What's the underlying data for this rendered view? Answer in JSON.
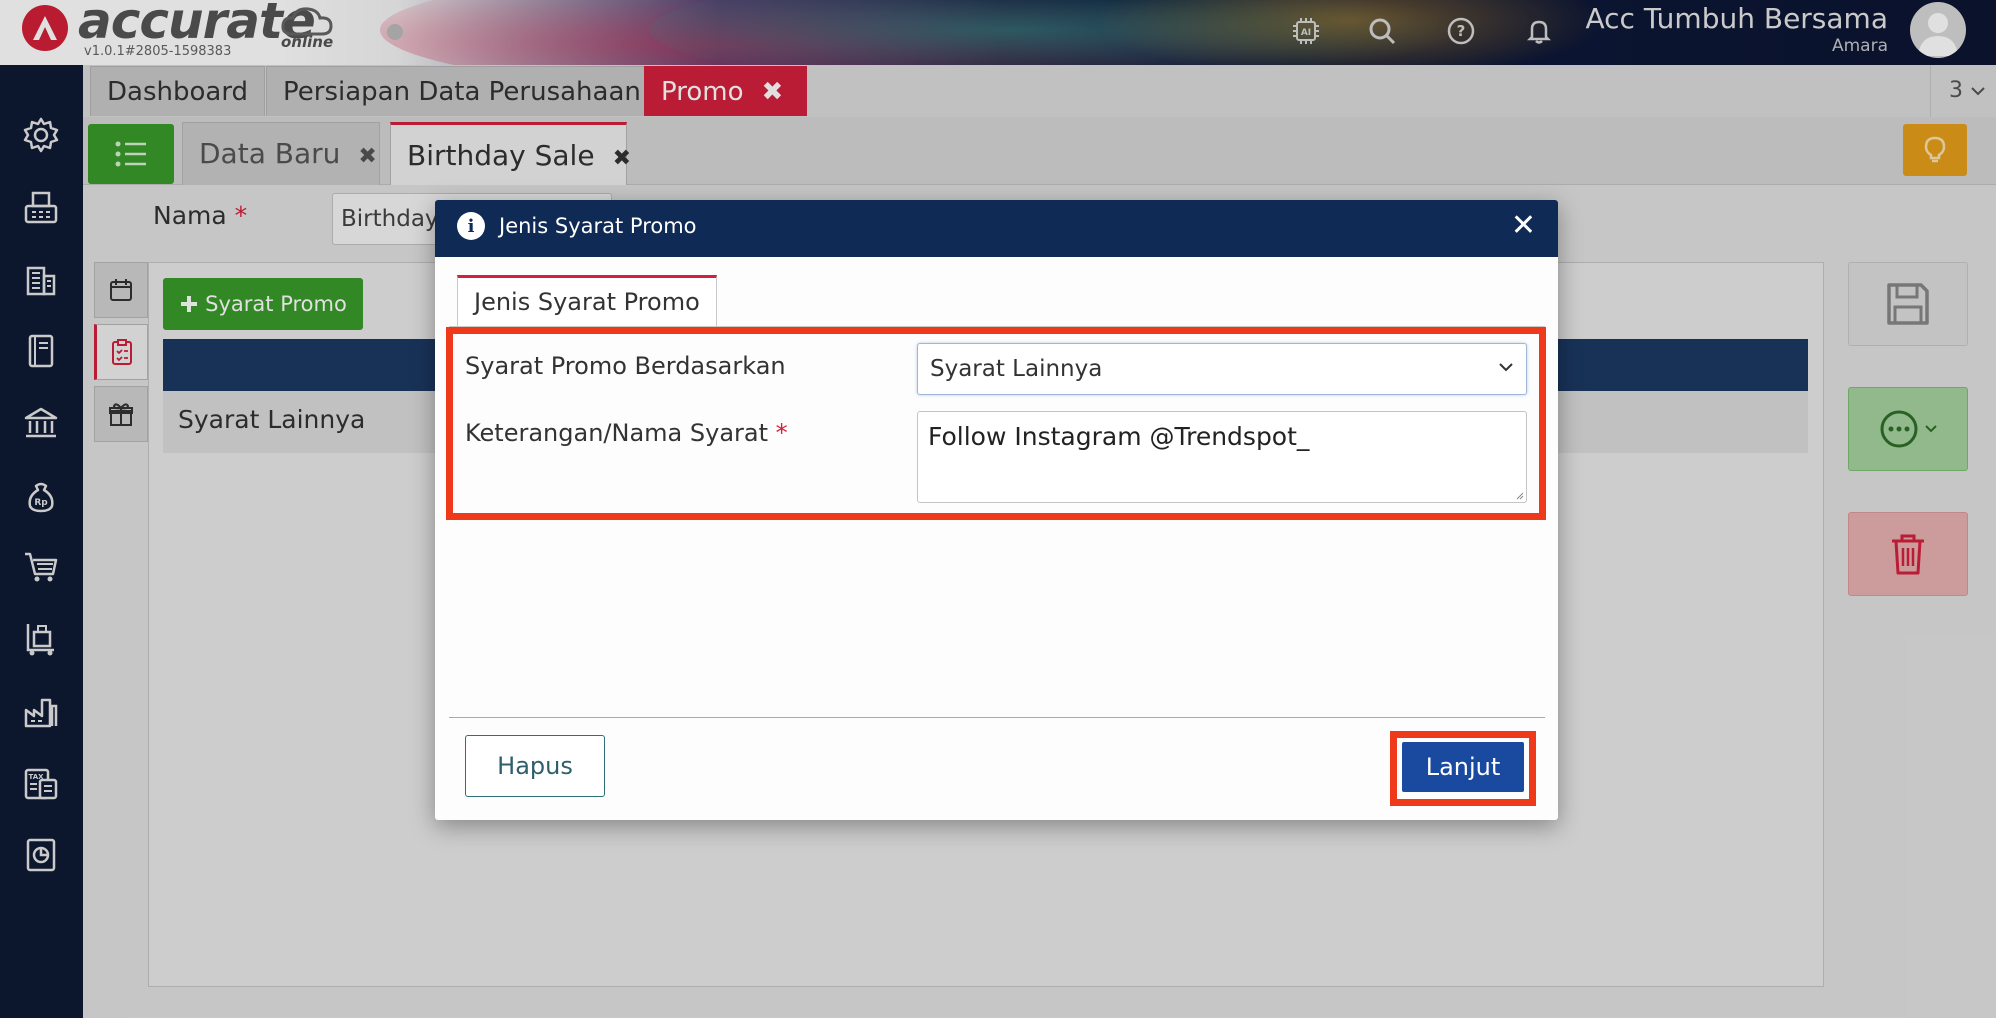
{
  "header": {
    "logo_text": "accurate",
    "logo_sub": "online",
    "version": "v1.0.1#2805-1598383",
    "company_name": "Acc Tumbuh Bersama",
    "user_name": "Amara",
    "icons": [
      "ai-icon",
      "search-icon",
      "help-icon",
      "bell-icon"
    ]
  },
  "sidebar": {
    "icons": [
      "gear-icon",
      "fax-icon",
      "building-icon",
      "book-icon",
      "bank-icon",
      "money-bag-icon",
      "cart-icon",
      "trolley-icon",
      "factory-icon",
      "tax-icon",
      "report-icon"
    ]
  },
  "app_tabs": [
    {
      "label": "Dashboard"
    },
    {
      "label": "Persiapan Data Perusahaan"
    },
    {
      "label": "Promo",
      "close": "✖"
    }
  ],
  "tab_count": "3",
  "sub_tabs": [
    {
      "label": "Data Baru",
      "close": "✖"
    },
    {
      "label": "Birthday Sale",
      "close": "✖"
    }
  ],
  "form": {
    "nama_label": "Nama",
    "required_mark": "*",
    "nama_value": "Birthday"
  },
  "panel": {
    "add_button": "Syarat Promo",
    "rows": [
      "Syarat Lainnya"
    ]
  },
  "modal": {
    "title": "Jenis Syarat Promo",
    "close": "✕",
    "tab": "Jenis Syarat Promo",
    "field1_label": "Syarat Promo Berdasarkan",
    "field1_value": "Syarat Lainnya",
    "field2_label": "Keterangan/Nama Syarat",
    "field2_required": "*",
    "field2_value": "Follow Instagram @Trendspot_",
    "btn_delete": "Hapus",
    "btn_next": "Lanjut"
  },
  "colors": {
    "brand_red": "#d3203c",
    "navy": "#0f2a55",
    "green": "#3a9b2a",
    "highlight": "#ee3a1b",
    "primary_button": "#1a4aa0"
  }
}
